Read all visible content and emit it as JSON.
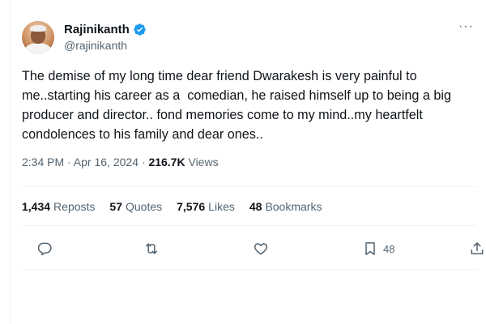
{
  "tweet": {
    "author": {
      "display_name": "Rajinikanth",
      "handle": "@rajinikanth",
      "verified": true
    },
    "more_icon": "more-horizontal-icon",
    "text": "The demise of my long time dear friend Dwarakesh is very painful to me..starting his career as a  comedian, he raised himself up to being a big producer and director.. fond memories come to my mind..my heartfelt condolences to his family and dear ones..",
    "timestamp": "2:34 PM · Apr 16, 2024",
    "separator": "·",
    "views_count": "216.7K",
    "views_label": "Views"
  },
  "stats": {
    "reposts": {
      "count": "1,434",
      "label": "Reposts"
    },
    "quotes": {
      "count": "57",
      "label": "Quotes"
    },
    "likes": {
      "count": "7,576",
      "label": "Likes"
    },
    "bookmarks": {
      "count": "48",
      "label": "Bookmarks"
    }
  },
  "actions": {
    "reply_icon": "reply-icon",
    "repost_icon": "repost-icon",
    "like_icon": "heart-icon",
    "bookmark_icon": "bookmark-icon",
    "bookmark_count": "48",
    "share_icon": "share-icon"
  },
  "colors": {
    "text": "#0f1419",
    "secondary": "#536471",
    "verified": "#1d9bf0",
    "divider": "#eff3f4"
  }
}
